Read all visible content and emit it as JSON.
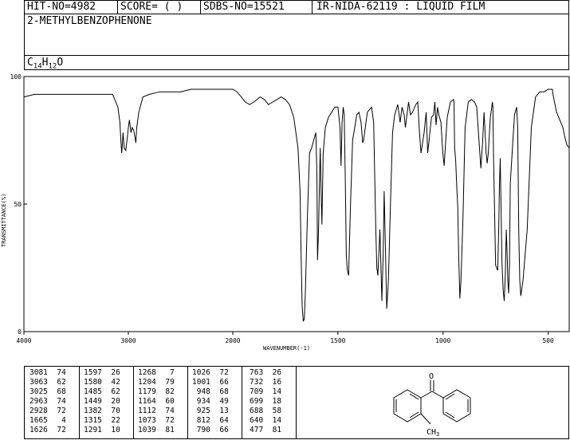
{
  "header": {
    "hit_no": "HIT-NO=4982",
    "score": "SCORE=  (   )",
    "sdbs_no": "SDBS-NO=15521",
    "ir_nida": "IR-NIDA-62119 : LIQUID FILM"
  },
  "compound": {
    "name": "2-METHYLBENZOPHENONE",
    "formula_parts": [
      "C",
      "14",
      "H",
      "12",
      "O"
    ]
  },
  "chart_data": {
    "type": "line",
    "title": "",
    "xlabel": "WAVENUMBER(-1)",
    "ylabel": "TRANSMITTANCE(%)",
    "xlim": [
      4000,
      400
    ],
    "ylim": [
      0,
      100
    ],
    "x_ticks": [
      4000,
      3000,
      2000,
      1500,
      1000,
      500
    ],
    "x_tick_labels": [
      "4000",
      "3000",
      "2000",
      "1500",
      "1000",
      "500"
    ],
    "y_ticks": [
      0,
      50,
      100
    ],
    "y_tick_labels": [
      "0",
      "50",
      "100"
    ],
    "grid": false,
    "series": [
      {
        "color": "#000000",
        "x": [
          4000,
          3900,
          3700,
          3500,
          3400,
          3300,
          3200,
          3150,
          3100,
          3081,
          3070,
          3063,
          3050,
          3040,
          3025,
          3010,
          3000,
          2990,
          2975,
          2963,
          2950,
          2935,
          2928,
          2920,
          2900,
          2880,
          2860,
          2800,
          2700,
          2600,
          2500,
          2400,
          2300,
          2200,
          2100,
          2000,
          1980,
          1960,
          1940,
          1920,
          1900,
          1870,
          1850,
          1830,
          1810,
          1790,
          1770,
          1750,
          1730,
          1710,
          1690,
          1680,
          1675,
          1670,
          1665,
          1660,
          1655,
          1645,
          1635,
          1625,
          1615,
          1605,
          1600,
          1597,
          1592,
          1588,
          1584,
          1580,
          1576,
          1570,
          1560,
          1545,
          1530,
          1515,
          1500,
          1490,
          1485,
          1480,
          1475,
          1470,
          1465,
          1460,
          1455,
          1449,
          1440,
          1430,
          1410,
          1400,
          1390,
          1382,
          1378,
          1370,
          1360,
          1340,
          1330,
          1320,
          1315,
          1310,
          1300,
          1291,
          1285,
          1280,
          1268,
          1260,
          1250,
          1240,
          1230,
          1215,
          1204,
          1195,
          1185,
          1179,
          1170,
          1164,
          1155,
          1145,
          1130,
          1120,
          1112,
          1105,
          1090,
          1080,
          1073,
          1065,
          1055,
          1045,
          1039,
          1033,
          1026,
          1020,
          1010,
          1001,
          995,
          980,
          965,
          950,
          948,
          945,
          940,
          934,
          930,
          925,
          920,
          915,
          905,
          895,
          880,
          865,
          850,
          840,
          830,
          820,
          812,
          805,
          795,
          790,
          785,
          775,
          765,
          763,
          760,
          750,
          740,
          735,
          732,
          728,
          720,
          714,
          709,
          704,
          699,
          695,
          692,
          688,
          684,
          680,
          670,
          660,
          650,
          645,
          640,
          635,
          630,
          620,
          600,
          580,
          560,
          540,
          520,
          500,
          490,
          480,
          477,
          470,
          460,
          450,
          440,
          430,
          420,
          410,
          400
        ],
        "y": [
          92,
          93,
          93,
          93,
          93,
          93,
          93,
          93,
          88,
          82,
          74,
          70,
          78,
          72,
          71,
          76,
          80,
          83,
          78,
          80,
          79,
          76,
          74,
          80,
          86,
          89,
          92,
          93,
          94,
          94,
          94,
          95,
          95,
          95,
          95,
          95,
          94,
          92,
          90,
          89,
          90,
          92,
          91,
          89,
          90,
          91,
          92,
          91,
          89,
          84,
          72,
          55,
          30,
          10,
          4,
          5,
          15,
          45,
          70,
          72,
          75,
          78,
          62,
          28,
          40,
          58,
          72,
          55,
          42,
          70,
          80,
          84,
          86,
          88,
          88,
          80,
          65,
          82,
          88,
          85,
          60,
          30,
          24,
          22,
          50,
          75,
          85,
          86,
          82,
          74,
          75,
          80,
          86,
          88,
          82,
          40,
          25,
          22,
          40,
          12,
          30,
          55,
          9,
          20,
          50,
          78,
          85,
          89,
          82,
          88,
          85,
          80,
          86,
          90,
          85,
          86,
          89,
          90,
          78,
          70,
          78,
          86,
          70,
          76,
          84,
          85,
          90,
          81,
          88,
          85,
          82,
          70,
          65,
          84,
          90,
          91,
          90,
          72,
          67,
          55,
          49,
          28,
          13,
          20,
          45,
          80,
          90,
          91,
          90,
          88,
          76,
          64,
          74,
          86,
          70,
          66,
          70,
          84,
          90,
          88,
          70,
          26,
          24,
          40,
          56,
          68,
          28,
          16,
          12,
          22,
          40,
          30,
          20,
          15,
          26,
          58,
          72,
          85,
          88,
          80,
          40,
          20,
          14,
          20,
          40,
          80,
          92,
          94,
          94,
          95,
          95,
          95,
          93,
          90,
          86,
          84,
          82,
          80,
          76,
          73,
          72
        ]
      }
    ]
  },
  "peaks": [
    [
      [
        "3081",
        "74"
      ],
      [
        "3063",
        "62"
      ],
      [
        "3025",
        "68"
      ],
      [
        "2963",
        "74"
      ],
      [
        "2928",
        "72"
      ],
      [
        "1665",
        "4"
      ],
      [
        "1626",
        "72"
      ]
    ],
    [
      [
        "1597",
        "26"
      ],
      [
        "1580",
        "42"
      ],
      [
        "1485",
        "62"
      ],
      [
        "1449",
        "20"
      ],
      [
        "1382",
        "70"
      ],
      [
        "1315",
        "22"
      ],
      [
        "1291",
        "10"
      ]
    ],
    [
      [
        "1268",
        "7"
      ],
      [
        "1204",
        "79"
      ],
      [
        "1179",
        "82"
      ],
      [
        "1164",
        "60"
      ],
      [
        "1112",
        "74"
      ],
      [
        "1073",
        "72"
      ],
      [
        "1039",
        "81"
      ]
    ],
    [
      [
        "1026",
        "72"
      ],
      [
        "1001",
        "66"
      ],
      [
        "948",
        "68"
      ],
      [
        "934",
        "49"
      ],
      [
        "925",
        "13"
      ],
      [
        "812",
        "64"
      ],
      [
        "790",
        "66"
      ]
    ],
    [
      [
        "763",
        "26"
      ],
      [
        "732",
        "16"
      ],
      [
        "709",
        "14"
      ],
      [
        "699",
        "18"
      ],
      [
        "688",
        "58"
      ],
      [
        "640",
        "14"
      ],
      [
        "477",
        "81"
      ]
    ]
  ],
  "structure": {
    "oxygen_label": "O",
    "methyl_label": "CH",
    "methyl_sub": "3"
  }
}
